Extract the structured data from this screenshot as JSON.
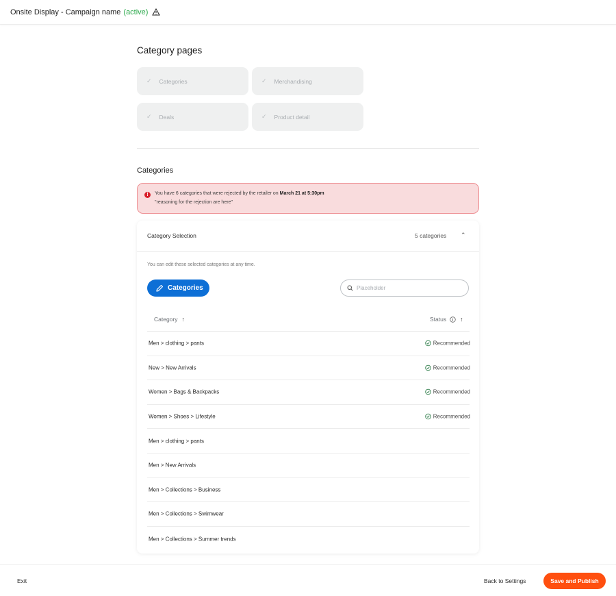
{
  "header": {
    "title": "Onsite Display - Campaign name",
    "status": "(active)",
    "warning_icon": "warning-triangle-icon",
    "status_color": "#2aa84a"
  },
  "category_pages": {
    "title": "Category pages",
    "pills": [
      {
        "label": "Categories",
        "icon": "check-icon"
      },
      {
        "label": "Merchandising",
        "icon": "check-icon"
      },
      {
        "label": "Deals",
        "icon": "check-icon"
      },
      {
        "label": "Product detail",
        "icon": "check-icon"
      }
    ]
  },
  "categories_section": {
    "heading": "Categories",
    "alert": {
      "text_prefix": "You have 6 categories that were rejected by the retailer on ",
      "text_bold": "March 21 at 5:30pm",
      "reason": "\"reasoning for the rejection are here\"",
      "icon": "error-icon",
      "bg_color": "#f9dcdd",
      "border_color": "#ee8f93"
    }
  },
  "selection_card": {
    "title": "Category Selection",
    "count": "5 categories",
    "help_text": "You can edit these selected categories at any time.",
    "edit_button_label": "Categories",
    "search_placeholder": "Placeholder",
    "columns": {
      "category": "Category",
      "status": "Status"
    },
    "rows": [
      {
        "path": "Men > clothing > pants",
        "status": "Recommended"
      },
      {
        "path": "New > New Arrivals",
        "status": "Recommended"
      },
      {
        "path": "Women > Bags & Backpacks",
        "status": "Recommended"
      },
      {
        "path": "Women > Shoes > Lifestyle",
        "status": "Recommended"
      },
      {
        "path": "Men > clothing > pants",
        "status": ""
      },
      {
        "path": "Men > New Arrivals",
        "status": ""
      },
      {
        "path": "Men > Collections > Business",
        "status": ""
      },
      {
        "path": "Men > Collections > Swimwear",
        "status": ""
      },
      {
        "path": "Men > Collections > Summer trends",
        "status": ""
      }
    ],
    "accent_color": "#0d6fd6"
  },
  "footer": {
    "exit_label": "Exit",
    "back_label": "Back to Settings",
    "publish_label": "Save and Publish",
    "publish_color": "#ff4f0f"
  }
}
